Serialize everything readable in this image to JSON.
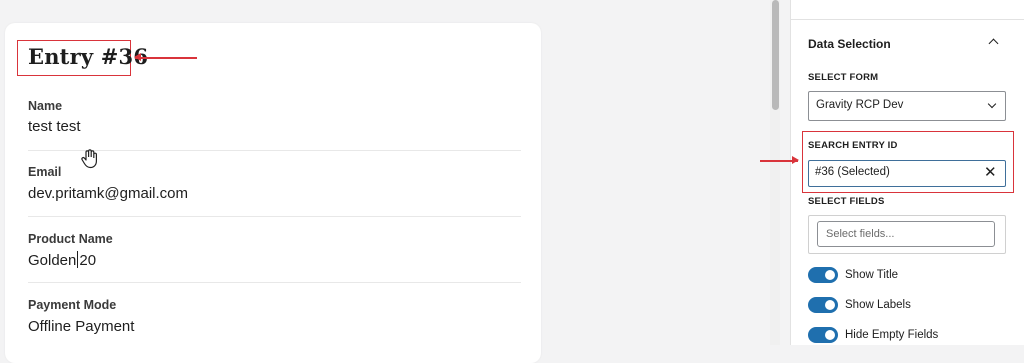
{
  "entry": {
    "title": "Entry #36",
    "fields": [
      {
        "label": "Name",
        "value": "test test"
      },
      {
        "label": "Email",
        "value": "dev.pritamk@gmail.com"
      },
      {
        "label": "Product Name",
        "value_before_caret": "Golden",
        "value_after_caret": "20"
      },
      {
        "label": "Payment Mode",
        "value": "Offline Payment"
      }
    ]
  },
  "panel": {
    "section_title": "Data Selection",
    "select_form": {
      "label": "SELECT FORM",
      "value": "Gravity RCP Dev"
    },
    "search_entry": {
      "label": "SEARCH ENTRY ID",
      "value": "#36 (Selected)",
      "clear_symbol": "✕"
    },
    "select_fields": {
      "label": "SELECT FIELDS",
      "placeholder": "Select fields..."
    },
    "toggles": [
      {
        "label": "Show Title",
        "on": true
      },
      {
        "label": "Show Labels",
        "on": true
      },
      {
        "label": "Hide Empty Fields",
        "on": true
      }
    ]
  },
  "colors": {
    "annotation_red": "#d9343b",
    "toggle_blue": "#1f6fae",
    "focus_border": "#3f6f9a"
  },
  "icons": {
    "cursor": "hand-pointer-icon",
    "collapse": "chevron-up-icon",
    "dropdown": "chevron-down-icon",
    "clear": "close-icon"
  }
}
